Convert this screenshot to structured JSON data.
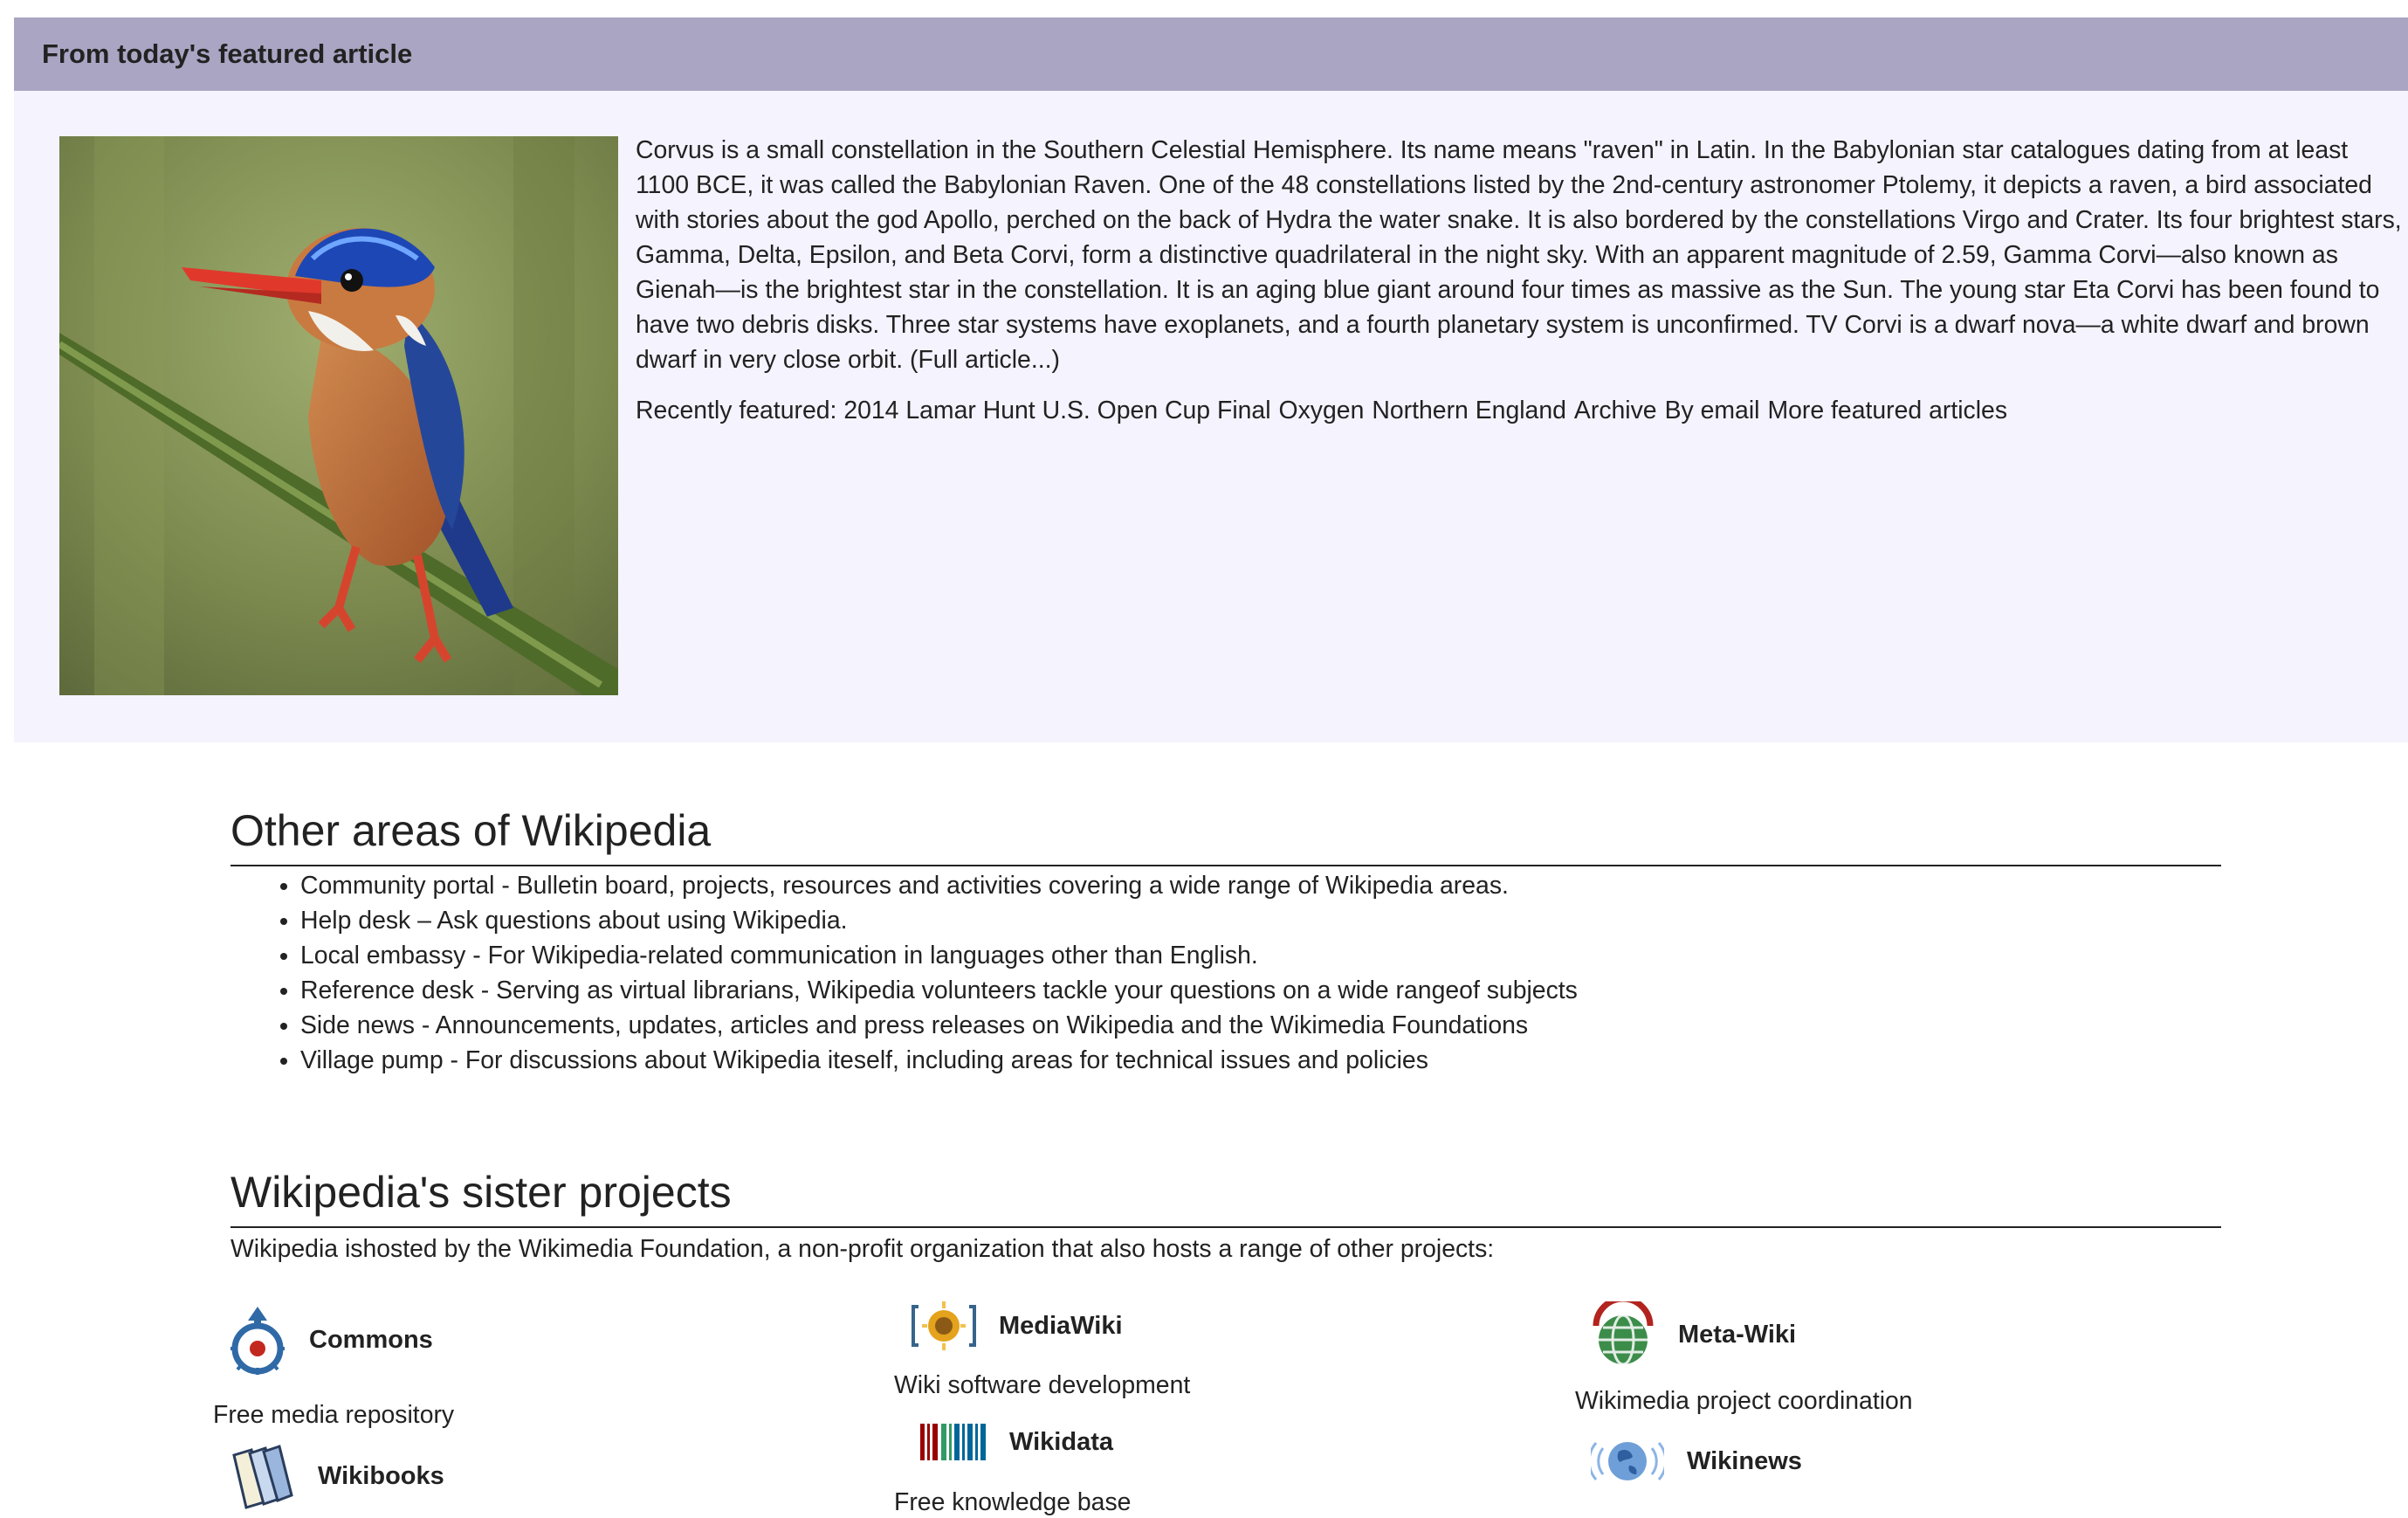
{
  "featured": {
    "heading": "From today's featured article",
    "paragraph": "Corvus is a small constellation in the Southern Celestial Hemisphere. Its name means \"raven\" in Latin. In the Babylonian star catalogues dating from at least 1100 BCE, it was called the Babylonian Raven. One of the 48 constellations listed by the 2nd-century astronomer Ptolemy, it depicts a raven, a bird associated with stories about the god Apollo, perched on the back of Hydra the water snake. It is also bordered by the constellations Virgo and Crater. Its four brightest stars, Gamma, Delta, Epsilon, and Beta Corvi, form a distinctive quadrilateral in the night sky. With an apparent magnitude of 2.59, Gamma Corvi—also known as Gienah—is the brightest star in the constellation. It is an aging blue giant around four times as massive as the Sun. The young star Eta Corvi has been found to have two debris disks. Three star systems have exoplanets, and a fourth planetary system is unconfirmed. TV Corvi is a dwarf nova—a white dwarf and brown dwarf in very close orbit.",
    "full_article_link": "(Full article...)",
    "recently_featured_label": "Recently featured:",
    "recently_featured": [
      "2014 Lamar Hunt U.S. Open Cup Final",
      "Oxygen",
      "Northern England"
    ],
    "archive_link": "Archive",
    "email_link": "By email",
    "more_link": "More featured articles"
  },
  "other_areas": {
    "heading": "Other areas of Wikipedia",
    "items": [
      {
        "name": "Community portal",
        "desc": " - Bulletin board, projects, resources and activities covering a wide range of Wikipedia areas."
      },
      {
        "name": "Help desk",
        "desc": " – Ask questions about using Wikipedia."
      },
      {
        "name": "Local embassy",
        "desc": " - For Wikipedia-related communication in languages other than English."
      },
      {
        "name": "Reference desk",
        "desc": " - Serving as virtual librarians, Wikipedia volunteers tackle your questions on a wide rangeof subjects"
      },
      {
        "name": "Side news",
        "desc": " - Announcements, updates, articles and press releases on Wikipedia and the Wikimedia Foundations"
      },
      {
        "name": "Village pump",
        "desc": " - For discussions about Wikipedia iteself, including areas for technical issues and policies"
      }
    ]
  },
  "sister": {
    "heading": "Wikipedia's sister projects",
    "intro": "Wikipedia ishosted by the Wikimedia Foundation, a non-profit organization that also hosts a range of other projects:",
    "projects": [
      {
        "name": "Commons",
        "desc": "Free media repository",
        "icon": "commons-icon"
      },
      {
        "name": "Wikibooks",
        "icon": "wikibooks-icon"
      },
      {
        "name": "MediaWiki",
        "desc": "Wiki software development",
        "icon": "mediawiki-icon"
      },
      {
        "name": "Wikidata",
        "desc": "Free knowledge base",
        "icon": "wikidata-icon"
      },
      {
        "name": "Meta-Wiki",
        "desc": "Wikimedia project coordination",
        "icon": "metawiki-icon"
      },
      {
        "name": "Wikinews",
        "icon": "wikinews-icon"
      }
    ]
  },
  "colors": {
    "featured_header_bg": "#aba5c4",
    "featured_body_bg": "#f5f3fd",
    "text": "#222222"
  }
}
